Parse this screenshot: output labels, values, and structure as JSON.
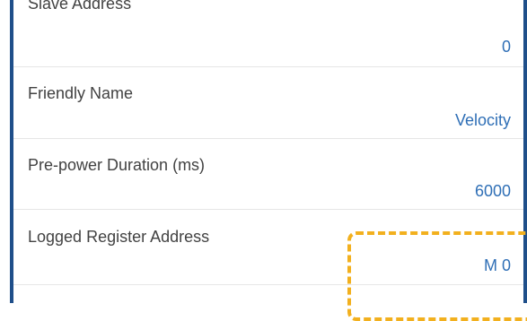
{
  "settings": {
    "rows": [
      {
        "label": "Slave Address",
        "value": "0"
      },
      {
        "label": "Friendly Name",
        "value": "Velocity"
      },
      {
        "label": "Pre-power Duration (ms)",
        "value": "6000"
      },
      {
        "label": "Logged Register Address",
        "value": "M 0"
      }
    ]
  },
  "colors": {
    "frame": "#1f4f8a",
    "label": "#424242",
    "value": "#2f6fb6",
    "highlight": "#f2b01e"
  }
}
